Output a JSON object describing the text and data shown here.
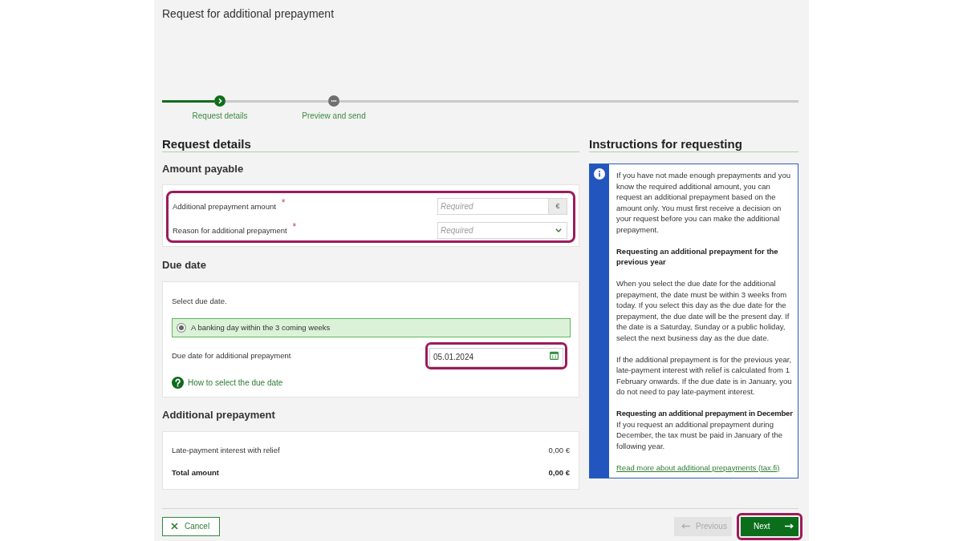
{
  "page": {
    "title": "Request for additional prepayment"
  },
  "steps": [
    {
      "label": "Request details",
      "selected": true
    },
    {
      "label": "Preview and send",
      "selected": false
    }
  ],
  "request_details": {
    "heading": "Request details",
    "amount_payable": {
      "heading": "Amount payable",
      "highlighted": true,
      "fields": [
        {
          "kind": "amount",
          "label": "Additional prepayment amount",
          "required_mark": "*",
          "placeholder": "Required",
          "unit": "€"
        },
        {
          "kind": "select",
          "label": "Reason for additional prepayment",
          "required_mark": "*",
          "placeholder": "Required"
        }
      ]
    },
    "due_date": {
      "heading": "Due date",
      "prompt": "Select due date.",
      "options": [
        {
          "label": "A banking day within the 3 coming weeks",
          "selected": true
        }
      ],
      "date_field": {
        "label": "Due date for additional prepayment",
        "value": "05.01.2024",
        "highlighted": true
      },
      "help_link": "How to select the due date"
    },
    "additional_prepayment": {
      "heading": "Additional prepayment",
      "rows": [
        {
          "kind": "item",
          "label": "Late-payment interest with relief",
          "value": "0,00 €"
        },
        {
          "kind": "total",
          "label": "Total amount",
          "value": "0,00 €"
        }
      ]
    }
  },
  "instructions": {
    "heading": "Instructions for requesting",
    "blocks": [
      {
        "kind": "paragraph",
        "text": "If you have not made enough prepayments and you know the required additional amount, you can request an additional prepayment based on the amount only. You must first receive a decision on your request before you can make the additional prepayment."
      },
      {
        "kind": "heading",
        "text": "Requesting an additional prepayment for the previous year"
      },
      {
        "kind": "paragraph",
        "text": "When you select the due date for the additional prepayment, the date must be within 3 weeks from today. If you select this day as the due date for the prepayment, the due date will be the present day. If the date is a Saturday, Sunday or a public holiday, select the next business day as the due date."
      },
      {
        "kind": "paragraph",
        "text": "If the additional prepayment is for the previous year, late-payment interest with relief is calculated from 1 February onwards. If the due date is in January, you do not need to pay late-payment interest."
      },
      {
        "kind": "section",
        "heading": "Requesting an additional prepayment in December",
        "text": "If you request an additional prepayment during December, the tax must be paid in January of the following year."
      }
    ],
    "link": "Read more about additional prepayments (tax.fi)"
  },
  "buttons": [
    {
      "kind": "cancel",
      "label": "Cancel",
      "disabled": false,
      "highlighted": false
    },
    {
      "kind": "previous",
      "label": "Previous",
      "disabled": true,
      "highlighted": false
    },
    {
      "kind": "next",
      "label": "Next",
      "disabled": false,
      "highlighted": true
    }
  ]
}
